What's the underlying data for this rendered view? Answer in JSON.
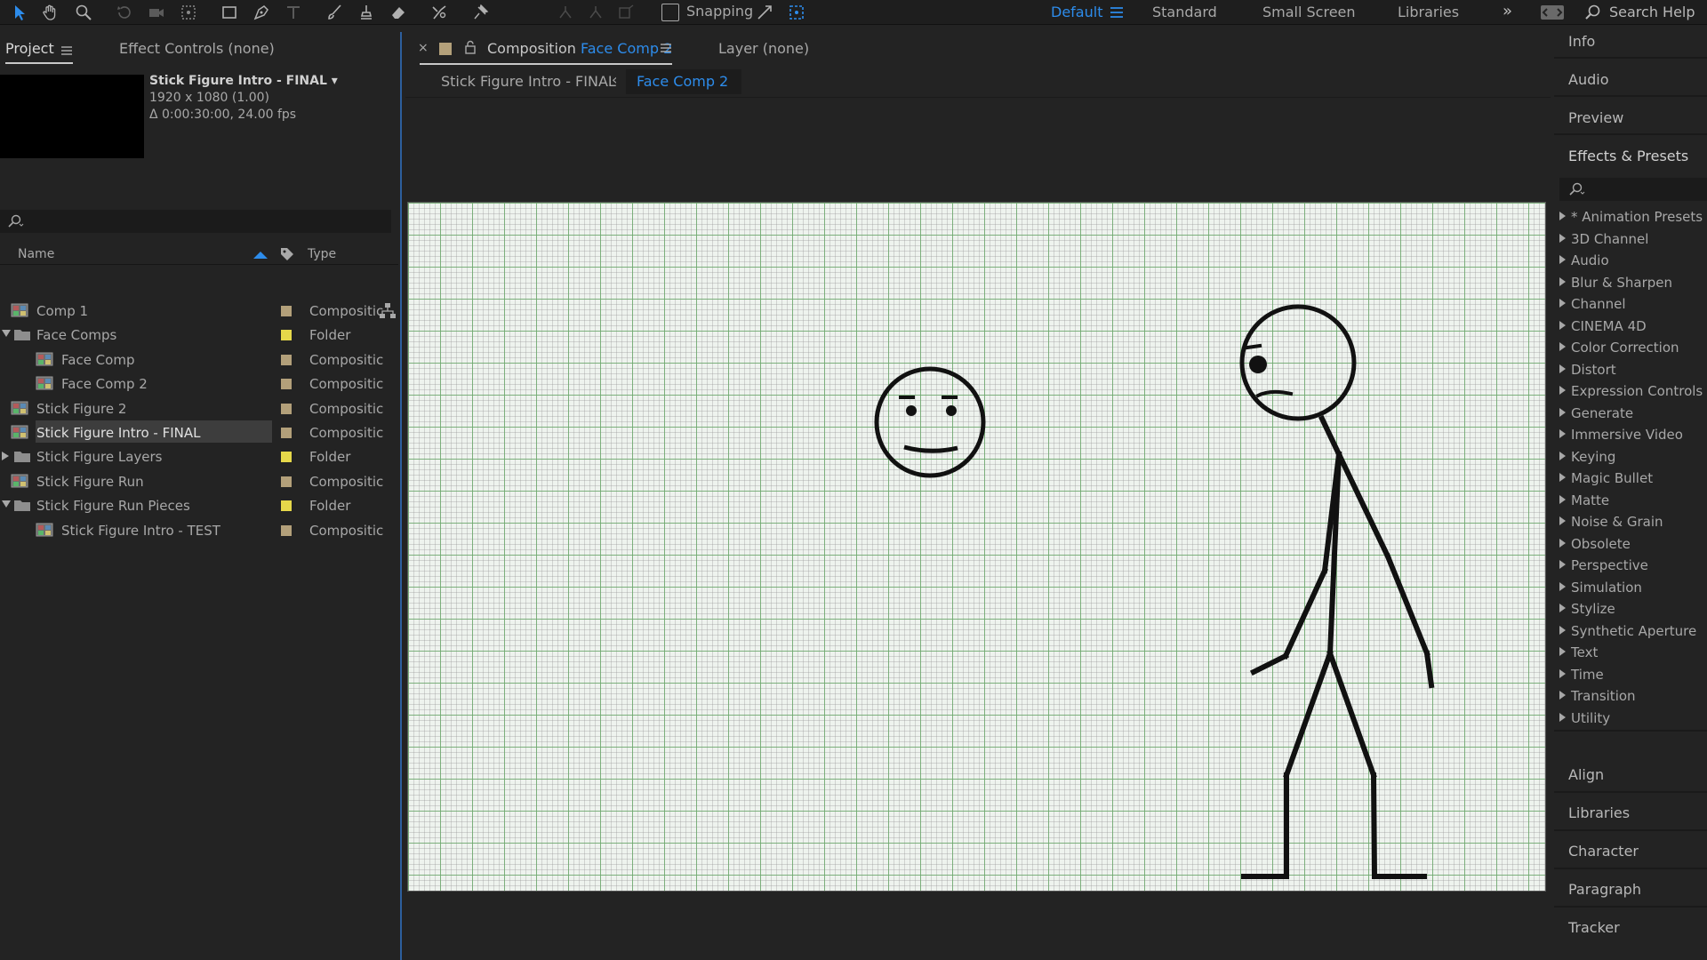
{
  "toolbar": {
    "snapping_label": "Snapping",
    "workspaces": [
      "Default",
      "Standard",
      "Small Screen",
      "Libraries"
    ],
    "active_workspace": "Default",
    "search_help": "Search Help",
    "accent": "#2d8ceb"
  },
  "left_panel": {
    "tabs": [
      "Project",
      "Effect Controls (none)"
    ],
    "selected_item": {
      "name": "Stick Figure Intro - FINAL ▾",
      "dimensions": "1920 x 1080 (1.00)",
      "duration": "Δ 0:00:30:00, 24.00 fps"
    },
    "columns": {
      "name": "Name",
      "type": "Type"
    },
    "items": [
      {
        "name": "Comp 1",
        "type": "Compositic",
        "kind": "comp",
        "indent": 0,
        "label_color": "#b3a07a"
      },
      {
        "name": "Face Comps",
        "type": "Folder",
        "kind": "folder",
        "indent": 0,
        "expanded": true,
        "label_color": "#e6d84a"
      },
      {
        "name": "Face Comp",
        "type": "Compositic",
        "kind": "comp",
        "indent": 1,
        "label_color": "#b3a07a"
      },
      {
        "name": "Face Comp 2",
        "type": "Compositic",
        "kind": "comp",
        "indent": 1,
        "label_color": "#b3a07a"
      },
      {
        "name": "Stick Figure 2",
        "type": "Compositic",
        "kind": "comp",
        "indent": 0,
        "label_color": "#b3a07a"
      },
      {
        "name": "Stick Figure Intro - FINAL",
        "type": "Compositic",
        "kind": "comp",
        "indent": 0,
        "selected": true,
        "label_color": "#b3a07a"
      },
      {
        "name": "Stick Figure Layers",
        "type": "Folder",
        "kind": "folder",
        "indent": 0,
        "expanded": false,
        "label_color": "#e6d84a"
      },
      {
        "name": "Stick Figure Run",
        "type": "Compositic",
        "kind": "comp",
        "indent": 0,
        "label_color": "#b3a07a"
      },
      {
        "name": "Stick Figure Run Pieces",
        "type": "Folder",
        "kind": "folder",
        "indent": 0,
        "expanded": true,
        "label_color": "#e6d84a"
      },
      {
        "name": "Stick Figure Intro - TEST",
        "type": "Compositic",
        "kind": "comp",
        "indent": 1,
        "label_color": "#b3a07a"
      }
    ]
  },
  "center": {
    "composition_prefix": "Composition",
    "composition_name": "Face Comp 2",
    "layer_tab": "Layer (none)",
    "breadcrumb_parent": "Stick Figure Intro - FINAL",
    "breadcrumb_current": "Face Comp 2"
  },
  "right_panel": {
    "top_items": [
      "Info",
      "Audio",
      "Preview",
      "Effects & Presets"
    ],
    "effects": [
      "* Animation Presets",
      "3D Channel",
      "Audio",
      "Blur & Sharpen",
      "Channel",
      "CINEMA 4D",
      "Color Correction",
      "Distort",
      "Expression Controls",
      "Generate",
      "Immersive Video",
      "Keying",
      "Magic Bullet",
      "Matte",
      "Noise & Grain",
      "Obsolete",
      "Perspective",
      "Simulation",
      "Stylize",
      "Synthetic Aperture",
      "Text",
      "Time",
      "Transition",
      "Utility"
    ],
    "bottom_items": [
      "Align",
      "Libraries",
      "Character",
      "Paragraph",
      "Tracker"
    ]
  }
}
